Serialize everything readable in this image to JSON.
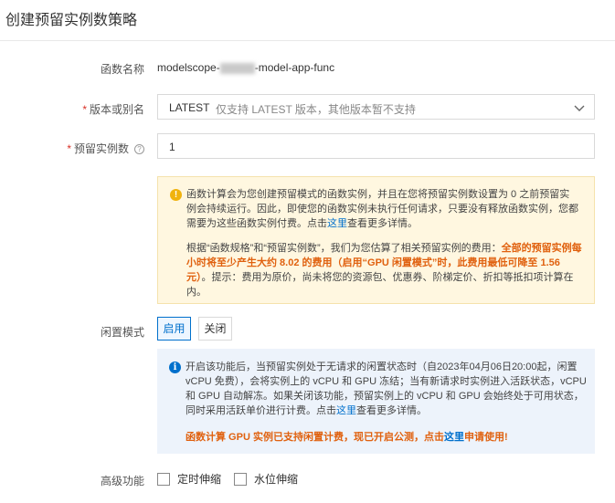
{
  "page": {
    "title": "创建预留实例数策略"
  },
  "function_name": {
    "label": "函数名称",
    "value_prefix": "modelscope-",
    "value_suffix": "-model-app-func"
  },
  "version": {
    "label": "版本或别名",
    "value": "LATEST",
    "hint": "仅支持 LATEST 版本，其他版本暂不支持"
  },
  "reserved_count": {
    "label": "预留实例数",
    "value": "1"
  },
  "warning": {
    "p1_a": "函数计算会为您创建预留模式的函数实例，并且在您将预留实例数设置为 0 之前预留实例会持续运行。因此，即使您的函数实例未执行任何请求，只要没有释放函数实例，您都需要为这些函数实例付费。点击",
    "p1_link": "这里",
    "p1_b": "查看更多详情。",
    "p2_a": "根据“函数规格”和“预留实例数”，我们为您估算了相关预留实例的费用：",
    "p2_hl": "全部的预留实例每小时将至少产生大约 8.02 的费用（启用“GPU 闲置模式”时，此费用最低可降至 1.56 元）",
    "p2_b": "。提示：费用为原价，尚未将您的资源包、优惠券、阶梯定价、折扣等抵扣项计算在内。"
  },
  "idle_mode": {
    "label": "闲置模式",
    "on_label": "启用",
    "off_label": "关闭",
    "selected": "启用"
  },
  "info": {
    "p1_a": "开启该功能后，当预留实例处于无请求的闲置状态时（自2023年04月06日20:00起，闲置 vCPU 免费），会将实例上的 vCPU 和 GPU 冻结；当有新请求时实例进入活跃状态，vCPU 和 GPU 自动解冻。如果关闭该功能，预留实例上的 vCPU 和 GPU 会始终处于可用状态，同时采用活跃单价进行计费。点击",
    "p1_link": "这里",
    "p1_b": "查看更多详情。",
    "p2_a": "函数计算 GPU 实例已支持闲置计费，现已开启公测，点击",
    "p2_link": "这里",
    "p2_b": "申请使用!"
  },
  "advanced": {
    "label": "高级功能",
    "options": [
      "定时伸缩",
      "水位伸缩"
    ]
  },
  "colors": {
    "accent": "#0070cc",
    "highlight": "#e0610f",
    "warning_bg": "#fff7e0",
    "info_bg": "#edf3fb"
  }
}
